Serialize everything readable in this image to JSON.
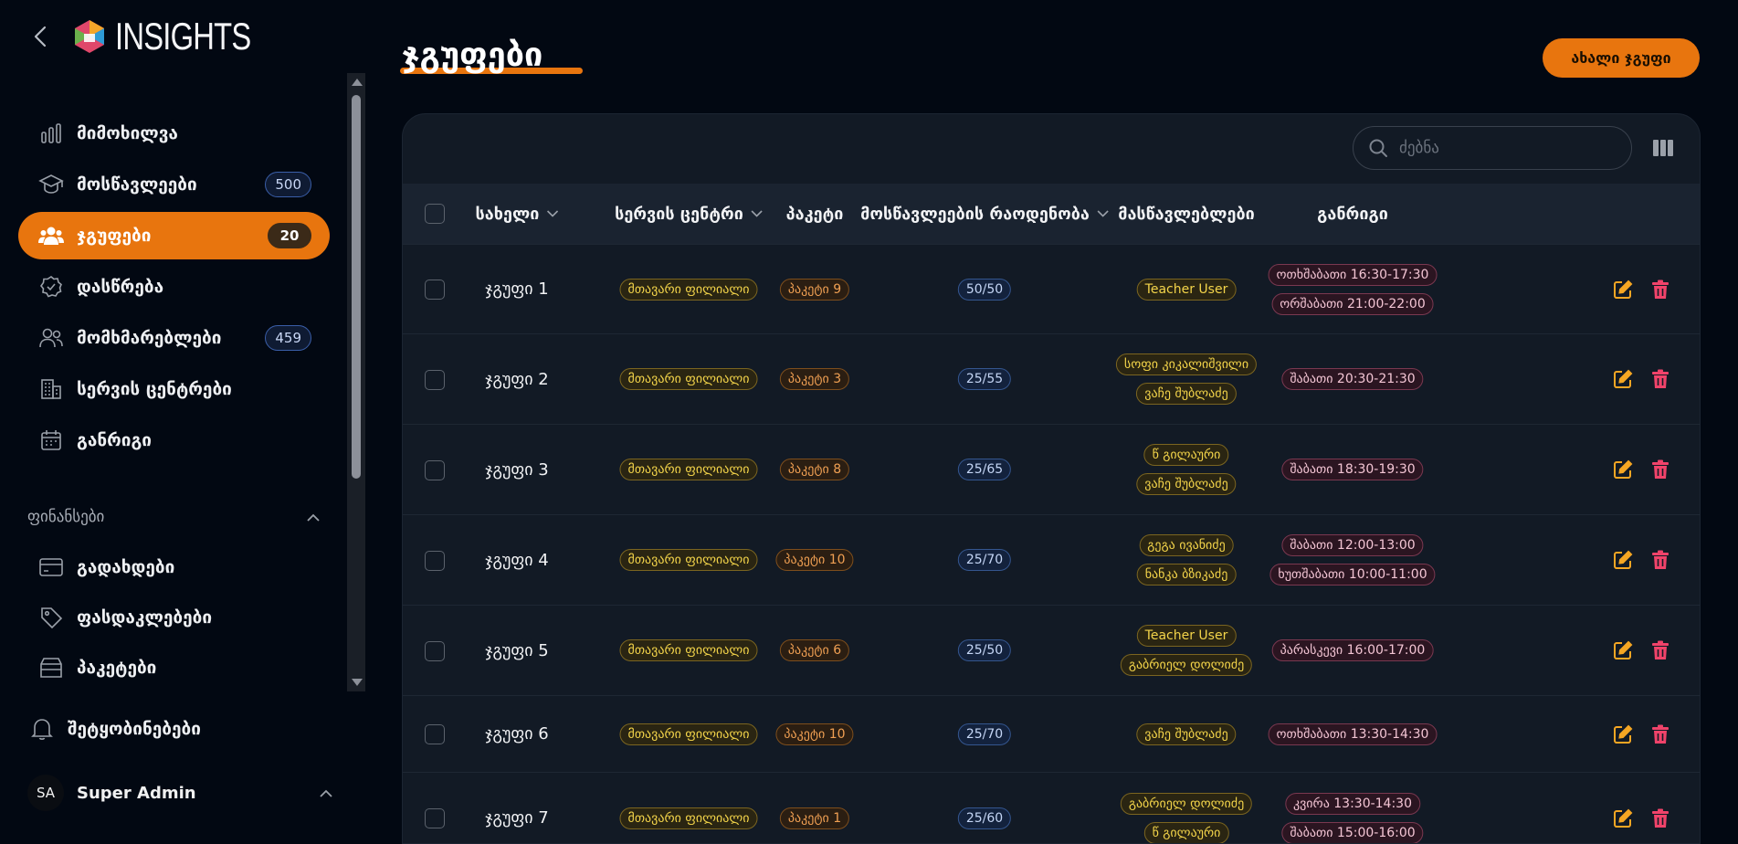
{
  "app": {
    "logo_text": "INSIGHTS"
  },
  "sidebar": {
    "items": [
      {
        "key": "overview",
        "label": "მიმოხილვა",
        "icon": "bar-chart-icon",
        "badge": null,
        "active": false
      },
      {
        "key": "students",
        "label": "მოსწავლეები",
        "icon": "graduation-cap-icon",
        "badge": "500",
        "active": false
      },
      {
        "key": "groups",
        "label": "ჯგუფები",
        "icon": "users-group-icon",
        "badge": "20",
        "active": true
      },
      {
        "key": "attendance",
        "label": "დასწრება",
        "icon": "check-badge-icon",
        "badge": null,
        "active": false
      },
      {
        "key": "users",
        "label": "მომხმარებლები",
        "icon": "users-icon",
        "badge": "459",
        "active": false
      },
      {
        "key": "service-centers",
        "label": "სერვის ცენტრები",
        "icon": "building-icon",
        "badge": null,
        "active": false
      },
      {
        "key": "schedule",
        "label": "განრიგი",
        "icon": "calendar-icon",
        "badge": null,
        "active": false
      }
    ],
    "finance_section": {
      "title": "ფინანსები",
      "items": [
        {
          "key": "payments",
          "label": "გადახდები",
          "icon": "credit-card-icon"
        },
        {
          "key": "discounts",
          "label": "ფასდაკლებები",
          "icon": "tag-icon"
        },
        {
          "key": "packages",
          "label": "პაკეტები",
          "icon": "package-icon"
        }
      ]
    },
    "notifications": {
      "label": "შეტყობინებები",
      "icon": "bell-icon"
    },
    "user": {
      "initials": "SA",
      "name": "Super Admin"
    }
  },
  "page": {
    "title": "ჯგუფები",
    "new_button": "ახალი ჯგუფი",
    "search_placeholder": "ძებნა"
  },
  "table": {
    "columns": [
      {
        "key": "name",
        "label": "სახელი",
        "sortable": true
      },
      {
        "key": "center",
        "label": "სერვის ცენტრი",
        "sortable": true
      },
      {
        "key": "package",
        "label": "პაკეტი",
        "sortable": false
      },
      {
        "key": "student_count",
        "label": "მოსწავლეების რაოდენობა",
        "sortable": true
      },
      {
        "key": "teachers",
        "label": "მასწავლებლები",
        "sortable": false
      },
      {
        "key": "schedule",
        "label": "განრიგი",
        "sortable": false
      }
    ],
    "rows": [
      {
        "name": "ჯგუფი 1",
        "center": "მთავარი ფილიალი",
        "package": "პაკეტი 9",
        "count": "50/50",
        "teachers": [
          "Teacher User"
        ],
        "schedule": [
          "ოთხშაბათი 16:30-17:30",
          "ორშაბათი 21:00-22:00"
        ]
      },
      {
        "name": "ჯგუფი 2",
        "center": "მთავარი ფილიალი",
        "package": "პაკეტი 3",
        "count": "25/55",
        "teachers": [
          "სოფი კიკალიშვილი",
          "ვაჩე შუბლაძე"
        ],
        "schedule": [
          "შაბათი 20:30-21:30"
        ]
      },
      {
        "name": "ჯგუფი 3",
        "center": "მთავარი ფილიალი",
        "package": "პაკეტი 8",
        "count": "25/65",
        "teachers": [
          "წ გილაური",
          "ვაჩე შუბლაძე"
        ],
        "schedule": [
          "შაბათი 18:30-19:30"
        ]
      },
      {
        "name": "ჯგუფი 4",
        "center": "მთავარი ფილიალი",
        "package": "პაკეტი 10",
        "count": "25/70",
        "teachers": [
          "გეგა ივანიძე",
          "ნანკა ბზიკაძე"
        ],
        "schedule": [
          "შაბათი 12:00-13:00",
          "ხუთშაბათი 10:00-11:00"
        ]
      },
      {
        "name": "ჯგუფი 5",
        "center": "მთავარი ფილიალი",
        "package": "პაკეტი 6",
        "count": "25/50",
        "teachers": [
          "Teacher User",
          "გაბრიელ დოლიძე"
        ],
        "schedule": [
          "პარასკევი 16:00-17:00"
        ]
      },
      {
        "name": "ჯგუფი 6",
        "center": "მთავარი ფილიალი",
        "package": "პაკეტი 10",
        "count": "25/70",
        "teachers": [
          "ვაჩე შუბლაძე"
        ],
        "schedule": [
          "ოთხშაბათი 13:30-14:30"
        ]
      },
      {
        "name": "ჯგუფი 7",
        "center": "მთავარი ფილიალი",
        "package": "პაკეტი 1",
        "count": "25/60",
        "teachers": [
          "გაბრიელ დოლიძე",
          "წ გილაური"
        ],
        "schedule": [
          "კვირა 13:30-14:30",
          "შაბათი 15:00-16:00"
        ]
      }
    ]
  },
  "colors": {
    "accent": "#e8750e",
    "background": "#020812",
    "card": "#121a25",
    "danger": "#f0436a",
    "edit": "#f5a623"
  }
}
